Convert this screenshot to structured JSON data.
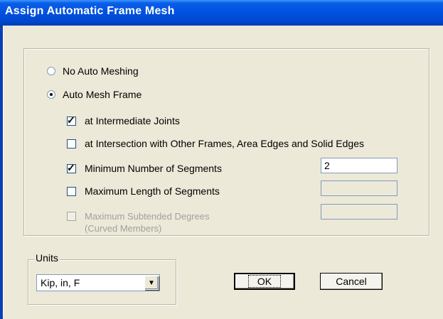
{
  "window": {
    "title": "Assign Automatic Frame Mesh"
  },
  "mesh_options": {
    "no_auto": {
      "label": "No Auto Meshing",
      "selected": false
    },
    "auto": {
      "label": "Auto Mesh Frame",
      "selected": true
    }
  },
  "checks": {
    "intermediate": {
      "label": "at Intermediate Joints",
      "checked": true
    },
    "intersection": {
      "label": "at Intersection with Other Frames,  Area Edges and Solid Edges",
      "checked": false
    },
    "min_segments": {
      "label": "Minimum Number of Segments",
      "checked": true,
      "value": "2"
    },
    "max_length": {
      "label": "Maximum Length of Segments",
      "checked": false,
      "value": ""
    },
    "max_degrees": {
      "label": "Maximum Subtended Degrees",
      "sublabel": "(Curved Members)",
      "checked": false,
      "value": "",
      "disabled": true
    }
  },
  "units": {
    "legend": "Units",
    "selected": "Kip, in, F"
  },
  "buttons": {
    "ok": "OK",
    "cancel": "Cancel"
  }
}
